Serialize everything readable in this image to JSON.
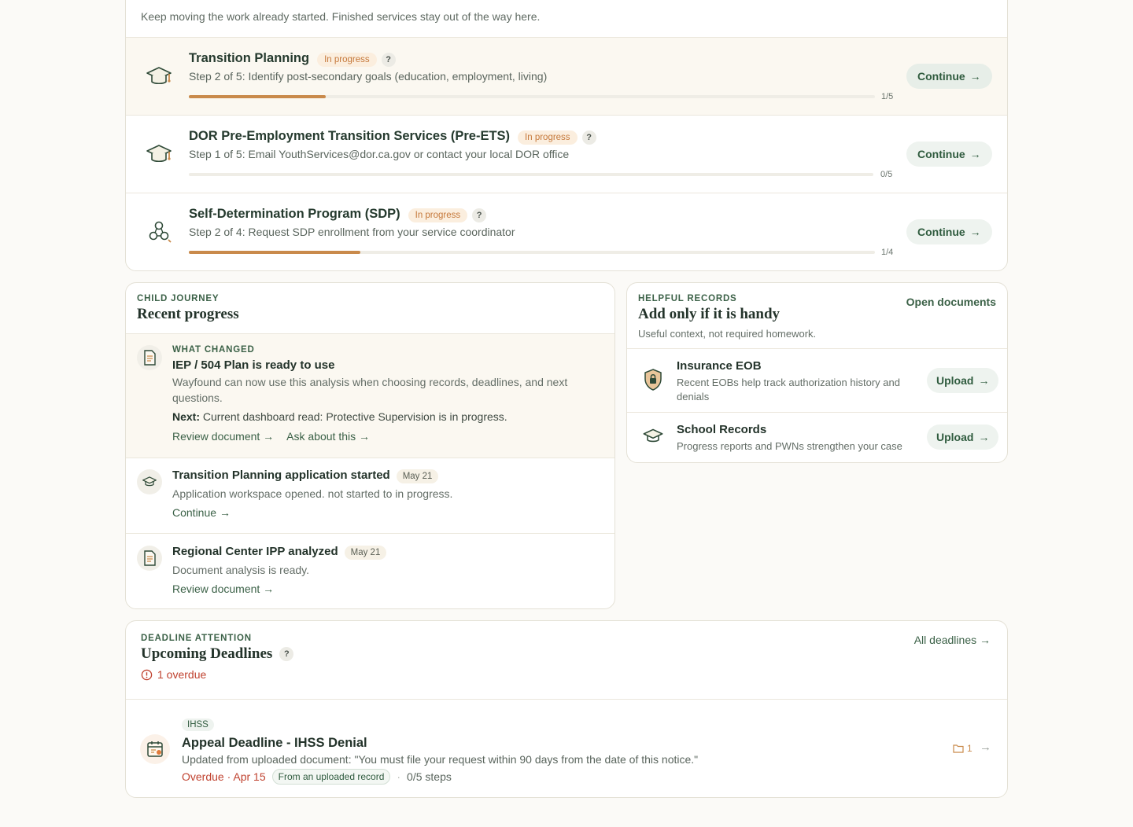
{
  "active_services": {
    "subtitle": "Keep moving the work already started. Finished services stay out of the way here.",
    "items": [
      {
        "title": "Transition Planning",
        "status": "In progress",
        "help": "?",
        "step": "Step 2 of 5: Identify post-secondary goals (education, employment, living)",
        "progress": 0.2,
        "progress_label": "1/5",
        "action": "Continue",
        "icon": "graduation-cap-icon"
      },
      {
        "title": "DOR Pre-Employment Transition Services (Pre-ETS)",
        "status": "In progress",
        "help": "?",
        "step": "Step 1 of 5: Email YouthServices@dor.ca.gov or contact your local DOR office",
        "progress": 0.0,
        "progress_label": "0/5",
        "action": "Continue",
        "icon": "graduation-cap-icon"
      },
      {
        "title": "Self-Determination Program (SDP)",
        "status": "In progress",
        "help": "?",
        "step": "Step 2 of 4: Request SDP enrollment from your service coordinator",
        "progress": 0.25,
        "progress_label": "1/4",
        "action": "Continue",
        "icon": "people-network-icon"
      }
    ]
  },
  "journey": {
    "eyebrow": "CHILD JOURNEY",
    "title": "Recent progress",
    "highlight": {
      "eyebrow": "WHAT CHANGED",
      "title": "IEP / 504 Plan is ready to use",
      "desc": "Wayfound can now use this analysis when choosing records, deadlines, and next questions.",
      "next_label": "Next:",
      "next_text": "Current dashboard read: Protective Supervision is in progress.",
      "link1": "Review document",
      "link2": "Ask about this"
    },
    "items": [
      {
        "title": "Transition Planning application started",
        "date": "May 21",
        "desc": "Application workspace opened. not started to in progress.",
        "link": "Continue"
      },
      {
        "title": "Regional Center IPP analyzed",
        "date": "May 21",
        "desc": "Document analysis is ready.",
        "link": "Review document"
      }
    ]
  },
  "records": {
    "eyebrow": "HELPFUL RECORDS",
    "title": "Add only if it is handy",
    "subtitle": "Useful context, not required homework.",
    "open_link": "Open documents",
    "items": [
      {
        "title": "Insurance EOB",
        "desc": "Recent EOBs help track authorization history and denials",
        "action": "Upload"
      },
      {
        "title": "School Records",
        "desc": "Progress reports and PWNs strengthen your case",
        "action": "Upload"
      }
    ]
  },
  "deadlines": {
    "eyebrow": "DEADLINE ATTENTION",
    "title": "Upcoming Deadlines",
    "help": "?",
    "overdue_count": "1 overdue",
    "all_link": "All deadlines",
    "item": {
      "tag": "IHSS",
      "title": "Appeal Deadline - IHSS Denial",
      "desc": "Updated from uploaded document: \"You must file your request within 90 days from the date of this notice.\"",
      "due": "Overdue · Apr 15",
      "source": "From an uploaded record",
      "sep": "·",
      "steps": "0/5 steps",
      "doc_count": "1"
    }
  },
  "colors": {
    "accent": "#3b6147",
    "progress": "#c98a4b",
    "overdue": "#c0422f",
    "badge": "#fbeede"
  }
}
